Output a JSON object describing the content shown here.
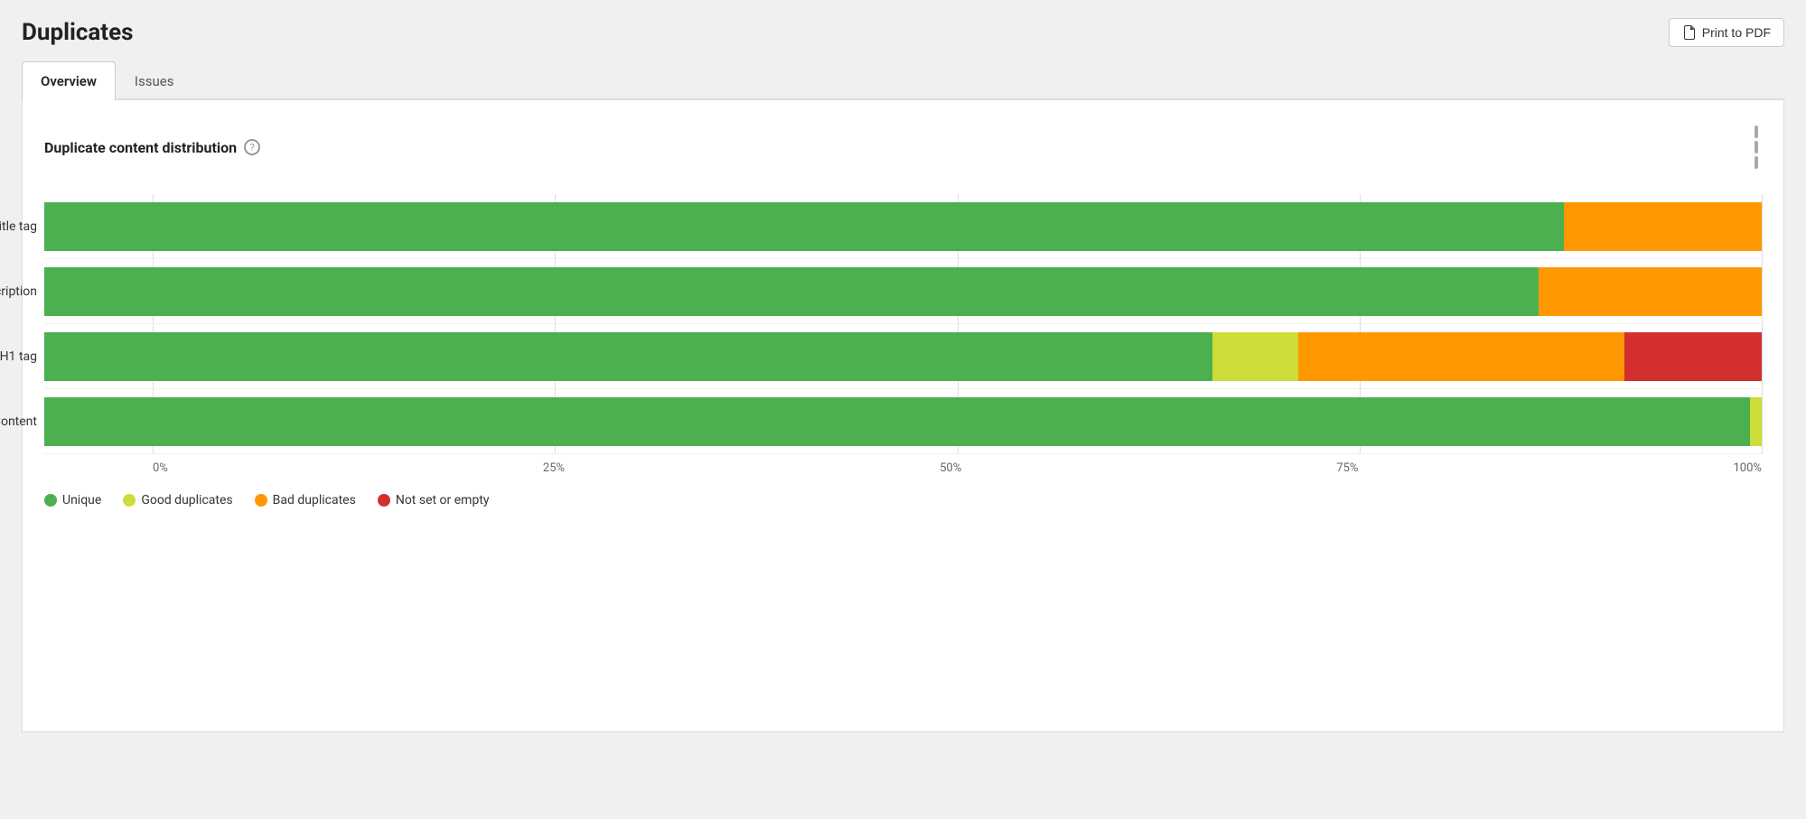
{
  "page": {
    "title": "Duplicates",
    "print_button_label": "Print to PDF"
  },
  "tabs": [
    {
      "id": "overview",
      "label": "Overview",
      "active": true
    },
    {
      "id": "issues",
      "label": "Issues",
      "active": false
    }
  ],
  "chart": {
    "title": "Duplicate content distribution",
    "help_icon": "?",
    "menu_icon": "bars-icon",
    "rows": [
      {
        "label": "Title tag",
        "segments": [
          {
            "type": "green",
            "pct": 88.5
          },
          {
            "type": "yellow",
            "pct": 0
          },
          {
            "type": "orange",
            "pct": 11.5
          },
          {
            "type": "red",
            "pct": 0
          }
        ]
      },
      {
        "label": "Description",
        "segments": [
          {
            "type": "green",
            "pct": 87
          },
          {
            "type": "yellow",
            "pct": 0
          },
          {
            "type": "orange",
            "pct": 13
          },
          {
            "type": "red",
            "pct": 0
          }
        ]
      },
      {
        "label": "H1 tag",
        "segments": [
          {
            "type": "green",
            "pct": 68
          },
          {
            "type": "yellow",
            "pct": 5
          },
          {
            "type": "orange",
            "pct": 19
          },
          {
            "type": "red",
            "pct": 8
          }
        ]
      },
      {
        "label": "Content",
        "segments": [
          {
            "type": "green",
            "pct": 99.3
          },
          {
            "type": "yellow",
            "pct": 0.7
          },
          {
            "type": "orange",
            "pct": 0
          },
          {
            "type": "red",
            "pct": 0
          }
        ]
      }
    ],
    "x_axis": [
      "0%",
      "25%",
      "50%",
      "75%",
      "100%"
    ],
    "legend": [
      {
        "id": "unique",
        "color": "#4caf50",
        "label": "Unique"
      },
      {
        "id": "good-duplicates",
        "color": "#cddc39",
        "label": "Good duplicates"
      },
      {
        "id": "bad-duplicates",
        "color": "#ff9800",
        "label": "Bad duplicates"
      },
      {
        "id": "not-set-or-empty",
        "color": "#d32f2f",
        "label": "Not set or empty"
      }
    ]
  }
}
